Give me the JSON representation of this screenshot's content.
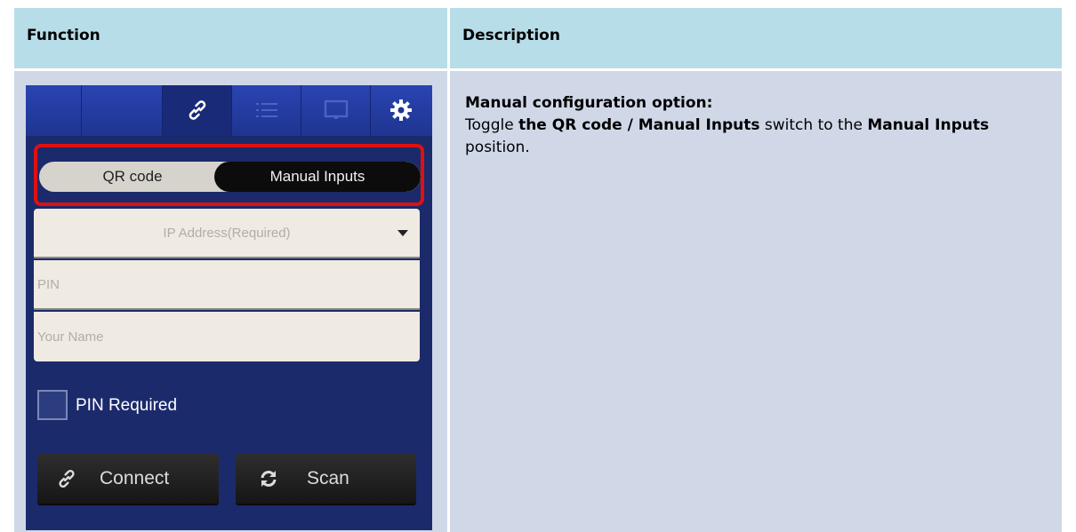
{
  "table": {
    "headers": {
      "function": "Function",
      "description": "Description"
    },
    "row": {
      "description": {
        "heading": "Manual configuration option:",
        "parts": [
          "Toggle ",
          "the QR code / Manual Inputs",
          " switch to the ",
          "Manual Inputs",
          " position."
        ]
      }
    }
  },
  "app": {
    "topbar": {
      "icons": [
        "link-icon",
        "list-icon",
        "display-icon",
        "gear-icon"
      ],
      "selected": "link-icon"
    },
    "toggle": {
      "off_label": "QR code",
      "on_label": "Manual Inputs",
      "selected": "Manual Inputs"
    },
    "fields": {
      "ip_placeholder": "IP Address(Required)",
      "pin_placeholder": "PIN",
      "name_placeholder": "Your Name"
    },
    "pin_required": {
      "label": "PIN Required",
      "checked": false
    },
    "buttons": {
      "connect": "Connect",
      "scan": "Scan"
    },
    "colors": {
      "highlight_border": "#e01010",
      "topbar": "#2a44b2",
      "background": "#1b2a6b"
    }
  }
}
